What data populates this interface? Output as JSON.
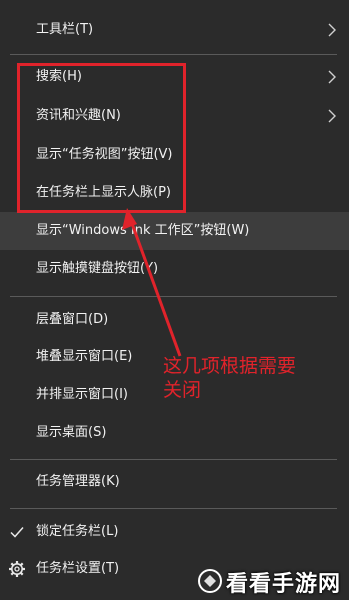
{
  "menu": {
    "items": [
      {
        "label": "工具栏(T)"
      },
      {
        "label": "搜索(H)"
      },
      {
        "label": "资讯和兴趣(N)"
      },
      {
        "label": "显示“任务视图”按钮(V)"
      },
      {
        "label": "在任务栏上显示人脉(P)"
      },
      {
        "label": "显示“Windows Ink 工作区”按钮(W)"
      },
      {
        "label": "显示触摸键盘按钮(Y)"
      },
      {
        "label": "层叠窗口(D)"
      },
      {
        "label": "堆叠显示窗口(E)"
      },
      {
        "label": "并排显示窗口(I)"
      },
      {
        "label": "显示桌面(S)"
      },
      {
        "label": "任务管理器(K)"
      },
      {
        "label": "锁定任务栏(L)"
      },
      {
        "label": "任务栏设置(T)"
      }
    ]
  },
  "annotation": {
    "text_line1": "这几项根据需要",
    "text_line2": "关闭",
    "color": "#e0232b"
  },
  "watermark": {
    "text": "看看手游网"
  },
  "colors": {
    "menu_bg": "#2b2b2b",
    "hover_bg": "#3d3d3d",
    "separator": "#5a5a5a",
    "accent_red": "#e0232b"
  }
}
